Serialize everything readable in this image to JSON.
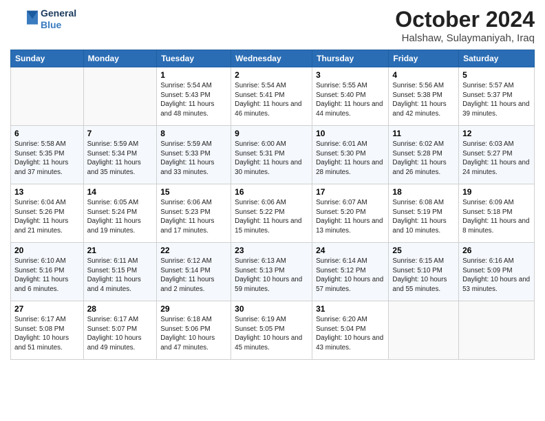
{
  "header": {
    "logo_general": "General",
    "logo_blue": "Blue",
    "month": "October 2024",
    "location": "Halshaw, Sulaymaniyah, Iraq"
  },
  "weekdays": [
    "Sunday",
    "Monday",
    "Tuesday",
    "Wednesday",
    "Thursday",
    "Friday",
    "Saturday"
  ],
  "weeks": [
    [
      {
        "day": "",
        "info": ""
      },
      {
        "day": "",
        "info": ""
      },
      {
        "day": "1",
        "info": "Sunrise: 5:54 AM\nSunset: 5:43 PM\nDaylight: 11 hours and 48 minutes."
      },
      {
        "day": "2",
        "info": "Sunrise: 5:54 AM\nSunset: 5:41 PM\nDaylight: 11 hours and 46 minutes."
      },
      {
        "day": "3",
        "info": "Sunrise: 5:55 AM\nSunset: 5:40 PM\nDaylight: 11 hours and 44 minutes."
      },
      {
        "day": "4",
        "info": "Sunrise: 5:56 AM\nSunset: 5:38 PM\nDaylight: 11 hours and 42 minutes."
      },
      {
        "day": "5",
        "info": "Sunrise: 5:57 AM\nSunset: 5:37 PM\nDaylight: 11 hours and 39 minutes."
      }
    ],
    [
      {
        "day": "6",
        "info": "Sunrise: 5:58 AM\nSunset: 5:35 PM\nDaylight: 11 hours and 37 minutes."
      },
      {
        "day": "7",
        "info": "Sunrise: 5:59 AM\nSunset: 5:34 PM\nDaylight: 11 hours and 35 minutes."
      },
      {
        "day": "8",
        "info": "Sunrise: 5:59 AM\nSunset: 5:33 PM\nDaylight: 11 hours and 33 minutes."
      },
      {
        "day": "9",
        "info": "Sunrise: 6:00 AM\nSunset: 5:31 PM\nDaylight: 11 hours and 30 minutes."
      },
      {
        "day": "10",
        "info": "Sunrise: 6:01 AM\nSunset: 5:30 PM\nDaylight: 11 hours and 28 minutes."
      },
      {
        "day": "11",
        "info": "Sunrise: 6:02 AM\nSunset: 5:28 PM\nDaylight: 11 hours and 26 minutes."
      },
      {
        "day": "12",
        "info": "Sunrise: 6:03 AM\nSunset: 5:27 PM\nDaylight: 11 hours and 24 minutes."
      }
    ],
    [
      {
        "day": "13",
        "info": "Sunrise: 6:04 AM\nSunset: 5:26 PM\nDaylight: 11 hours and 21 minutes."
      },
      {
        "day": "14",
        "info": "Sunrise: 6:05 AM\nSunset: 5:24 PM\nDaylight: 11 hours and 19 minutes."
      },
      {
        "day": "15",
        "info": "Sunrise: 6:06 AM\nSunset: 5:23 PM\nDaylight: 11 hours and 17 minutes."
      },
      {
        "day": "16",
        "info": "Sunrise: 6:06 AM\nSunset: 5:22 PM\nDaylight: 11 hours and 15 minutes."
      },
      {
        "day": "17",
        "info": "Sunrise: 6:07 AM\nSunset: 5:20 PM\nDaylight: 11 hours and 13 minutes."
      },
      {
        "day": "18",
        "info": "Sunrise: 6:08 AM\nSunset: 5:19 PM\nDaylight: 11 hours and 10 minutes."
      },
      {
        "day": "19",
        "info": "Sunrise: 6:09 AM\nSunset: 5:18 PM\nDaylight: 11 hours and 8 minutes."
      }
    ],
    [
      {
        "day": "20",
        "info": "Sunrise: 6:10 AM\nSunset: 5:16 PM\nDaylight: 11 hours and 6 minutes."
      },
      {
        "day": "21",
        "info": "Sunrise: 6:11 AM\nSunset: 5:15 PM\nDaylight: 11 hours and 4 minutes."
      },
      {
        "day": "22",
        "info": "Sunrise: 6:12 AM\nSunset: 5:14 PM\nDaylight: 11 hours and 2 minutes."
      },
      {
        "day": "23",
        "info": "Sunrise: 6:13 AM\nSunset: 5:13 PM\nDaylight: 10 hours and 59 minutes."
      },
      {
        "day": "24",
        "info": "Sunrise: 6:14 AM\nSunset: 5:12 PM\nDaylight: 10 hours and 57 minutes."
      },
      {
        "day": "25",
        "info": "Sunrise: 6:15 AM\nSunset: 5:10 PM\nDaylight: 10 hours and 55 minutes."
      },
      {
        "day": "26",
        "info": "Sunrise: 6:16 AM\nSunset: 5:09 PM\nDaylight: 10 hours and 53 minutes."
      }
    ],
    [
      {
        "day": "27",
        "info": "Sunrise: 6:17 AM\nSunset: 5:08 PM\nDaylight: 10 hours and 51 minutes."
      },
      {
        "day": "28",
        "info": "Sunrise: 6:17 AM\nSunset: 5:07 PM\nDaylight: 10 hours and 49 minutes."
      },
      {
        "day": "29",
        "info": "Sunrise: 6:18 AM\nSunset: 5:06 PM\nDaylight: 10 hours and 47 minutes."
      },
      {
        "day": "30",
        "info": "Sunrise: 6:19 AM\nSunset: 5:05 PM\nDaylight: 10 hours and 45 minutes."
      },
      {
        "day": "31",
        "info": "Sunrise: 6:20 AM\nSunset: 5:04 PM\nDaylight: 10 hours and 43 minutes."
      },
      {
        "day": "",
        "info": ""
      },
      {
        "day": "",
        "info": ""
      }
    ]
  ]
}
